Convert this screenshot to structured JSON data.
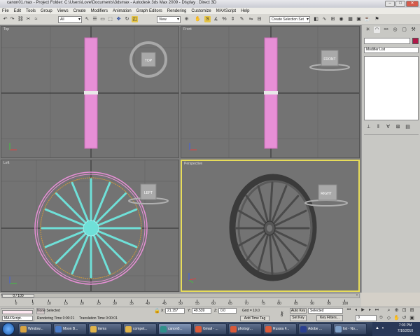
{
  "window": {
    "title": "canon01.max - Project Folder: C:\\Users\\Love\\Documents\\3dsmax - Autodesk 3ds Max 2009 - Display : Direct 3D",
    "minimize": "–",
    "maximize": "□",
    "close": "✕"
  },
  "menu": [
    "File",
    "Edit",
    "Tools",
    "Group",
    "Views",
    "Create",
    "Modifiers",
    "Animation",
    "Graph Editors",
    "Rendering",
    "Customize",
    "MAXScript",
    "Help"
  ],
  "toolbar": {
    "filter_select": "All",
    "view_select": "View",
    "selection_set": "Create Selection Set"
  },
  "viewports": {
    "top": {
      "label": "Top",
      "cube": "TOP"
    },
    "front": {
      "label": "Front",
      "cube": "FRONT"
    },
    "left": {
      "label": "Left",
      "cube": "LEFT"
    },
    "perspective": {
      "label": "Perspective",
      "cube": "RIGHT"
    }
  },
  "command_panel": {
    "modifier_list": "Modifier List"
  },
  "timeline": {
    "frame_counter": "0 / 100",
    "ticks": [
      "0",
      "5",
      "10",
      "15",
      "20",
      "25",
      "30",
      "35",
      "40",
      "45",
      "50",
      "55",
      "60",
      "65",
      "70",
      "75",
      "80",
      "85",
      "90",
      "95",
      "100"
    ]
  },
  "status": {
    "selection": "None Selected",
    "rendering_time": "Rendering Time  0:00:21",
    "translation_time": "Translation Time  0:00:01",
    "x_label": "X:",
    "x_value": "21.157",
    "y_label": "Y:",
    "y_value": "49.539",
    "z_label": "Z:",
    "z_value": "0.0",
    "grid": "Grid = 10.0",
    "add_time_tag": "Add Time Tag",
    "auto_key": "Auto Key",
    "set_key": "Set Key",
    "selected_select": "Selected",
    "key_filters": "Key Filters...",
    "frame_field": "0",
    "maxscript": "MAXScript."
  },
  "taskbar": {
    "items": [
      {
        "label": "Window...",
        "color": "#d9a441"
      },
      {
        "label": "Moon B...",
        "color": "#4a7bc8"
      },
      {
        "label": "items",
        "color": "#e0b44a"
      },
      {
        "label": "compet...",
        "color": "#e0b44a"
      },
      {
        "label": "canon0...",
        "color": "#2f8f8a"
      },
      {
        "label": "Gmail - ...",
        "color": "#d95a3a"
      },
      {
        "label": "photogr...",
        "color": "#d95a3a"
      },
      {
        "label": "Russia F...",
        "color": "#d95a3a"
      },
      {
        "label": "Adobe ...",
        "color": "#2a3f8f"
      },
      {
        "label": "list - No...",
        "color": "#7fa0c8"
      }
    ],
    "time": "7:03 PM",
    "date": "7/16/2010"
  },
  "colors": {
    "active_viewport_border": "#e7dc5a",
    "selection_pink": "#e78fd6",
    "wheel_cyan": "#6fe0d8",
    "taskbar": "#1c2a44"
  }
}
